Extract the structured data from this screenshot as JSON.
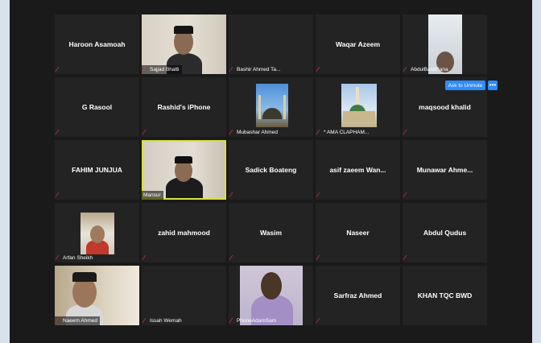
{
  "app": {
    "title": "Zoom Meeting - Gallery View"
  },
  "tiles": {
    "t1": {
      "name": "Haroon Asamoah",
      "muted": true
    },
    "t2": {
      "label": "Sajjad Bhatti",
      "muted": true
    },
    "t3": {
      "label": "Bashir Ahmed Ta...",
      "muted": true
    },
    "t4": {
      "name": "Waqar Azeem",
      "muted": true
    },
    "t5": {
      "label": "AbdulBasitRana",
      "muted": true
    },
    "t6": {
      "name": "G Rasool",
      "muted": true
    },
    "t7": {
      "name": "Rashid's iPhone",
      "muted": true
    },
    "t8": {
      "label": "Mubashar Ahmed",
      "muted": true
    },
    "t9": {
      "label": "* AMA CLAPHAM...",
      "muted": true
    },
    "t10": {
      "name": "maqsood khalid",
      "muted": true
    },
    "t11": {
      "name": "FAHIM JUNJUA",
      "muted": true
    },
    "t12": {
      "label": "Mansur",
      "muted": false,
      "active_speaker": true
    },
    "t13": {
      "name": "Sadick Boateng",
      "muted": true
    },
    "t14": {
      "name": "asif zaeem Wan...",
      "muted": true
    },
    "t15": {
      "name": "Munawar Ahme...",
      "muted": true
    },
    "t16": {
      "label": "Arfan Sheikh",
      "muted": true
    },
    "t17": {
      "name": "zahid mahmood",
      "muted": true
    },
    "t18": {
      "name": "Wasim",
      "muted": true
    },
    "t19": {
      "name": "Naseer",
      "muted": true
    },
    "t20": {
      "name": "Abdul Qudus",
      "muted": true
    },
    "t21": {
      "label": "Naeem Ahmed",
      "muted": true
    },
    "t22": {
      "label": "Issah Wemah",
      "muted": true
    },
    "t23": {
      "label": "PhoneAdamSam",
      "muted": true
    },
    "t24": {
      "name": "Sarfraz Ahmed",
      "muted": true
    },
    "t25": {
      "name": "KHAN TQC BWD",
      "muted": false
    }
  },
  "controls": {
    "ask_unmute_label": "Ask to Unmute",
    "more_label": "•••"
  },
  "icons": {
    "muted_mic": "muted-mic-icon"
  },
  "colors": {
    "background": "#1a1a1a",
    "tile": "#232323",
    "active_speaker_border": "#d8e23c",
    "muted_icon": "#e0363d",
    "button": "#2d8cff"
  }
}
